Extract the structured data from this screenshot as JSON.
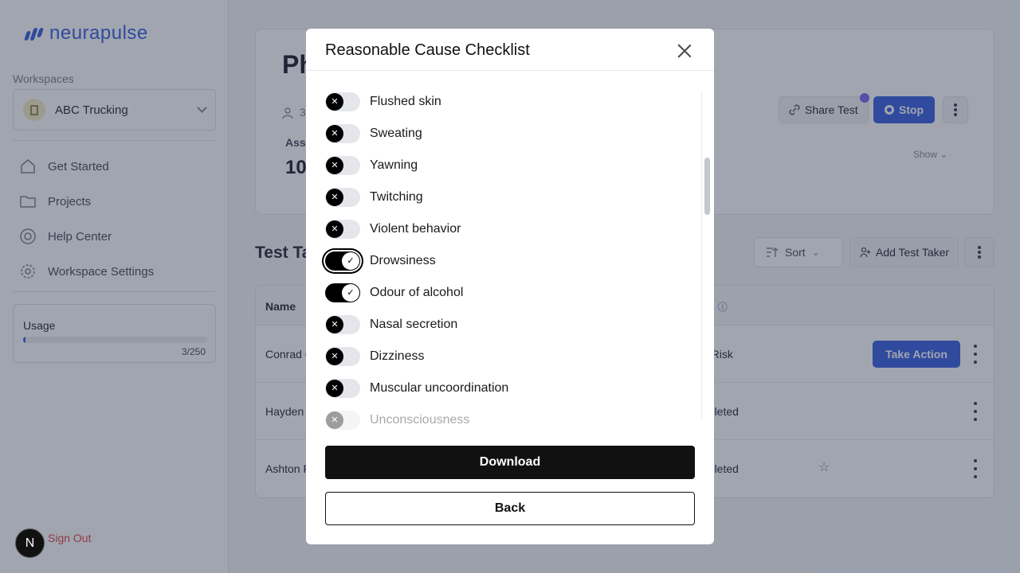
{
  "brand": {
    "name": "neurapulse",
    "accent": "#3d63e0"
  },
  "sidebar": {
    "workspaces_label": "Workspaces",
    "workspace": "ABC Trucking",
    "nav": [
      {
        "label": "Get Started",
        "icon": "home-icon"
      },
      {
        "label": "Projects",
        "icon": "folder-icon"
      },
      {
        "label": "Help Center",
        "icon": "lifebuoy-icon"
      },
      {
        "label": "Workspace Settings",
        "icon": "gear-icon"
      }
    ],
    "usage": {
      "label": "Usage",
      "count": "3/250",
      "fraction": 0.012
    },
    "sign_out": "Sign Out",
    "badge_letter": "N"
  },
  "project": {
    "title_partial": "Ph",
    "meta_partial": "3",
    "assess_label_partial": "Asse",
    "assess_value_partial": "10",
    "share_label": "Share Test",
    "stop_label": "Stop",
    "show_label": "Show"
  },
  "test_takers": {
    "title_partial": "Test Ta",
    "sort_label": "Sort",
    "add_label": "Add Test Taker",
    "columns": {
      "name": "Name",
      "status_partial": "s"
    },
    "rows": [
      {
        "name": "Conrad C",
        "status": "h Risk",
        "action": "Take Action"
      },
      {
        "name": "Hayden",
        "status": "npleted"
      },
      {
        "name": "Ashton F",
        "status": "npleted"
      }
    ]
  },
  "modal": {
    "title": "Reasonable Cause Checklist",
    "items": [
      {
        "label": "Flushed skin",
        "checked": false
      },
      {
        "label": "Sweating",
        "checked": false
      },
      {
        "label": "Yawning",
        "checked": false
      },
      {
        "label": "Twitching",
        "checked": false
      },
      {
        "label": "Violent behavior",
        "checked": false
      },
      {
        "label": "Drowsiness",
        "checked": true,
        "focused": true
      },
      {
        "label": "Odour of alcohol",
        "checked": true
      },
      {
        "label": "Nasal secretion",
        "checked": false
      },
      {
        "label": "Dizziness",
        "checked": false
      },
      {
        "label": "Muscular uncoordination",
        "checked": false
      },
      {
        "label": "Unconsciousness",
        "checked": false
      }
    ],
    "download_label": "Download",
    "back_label": "Back"
  }
}
